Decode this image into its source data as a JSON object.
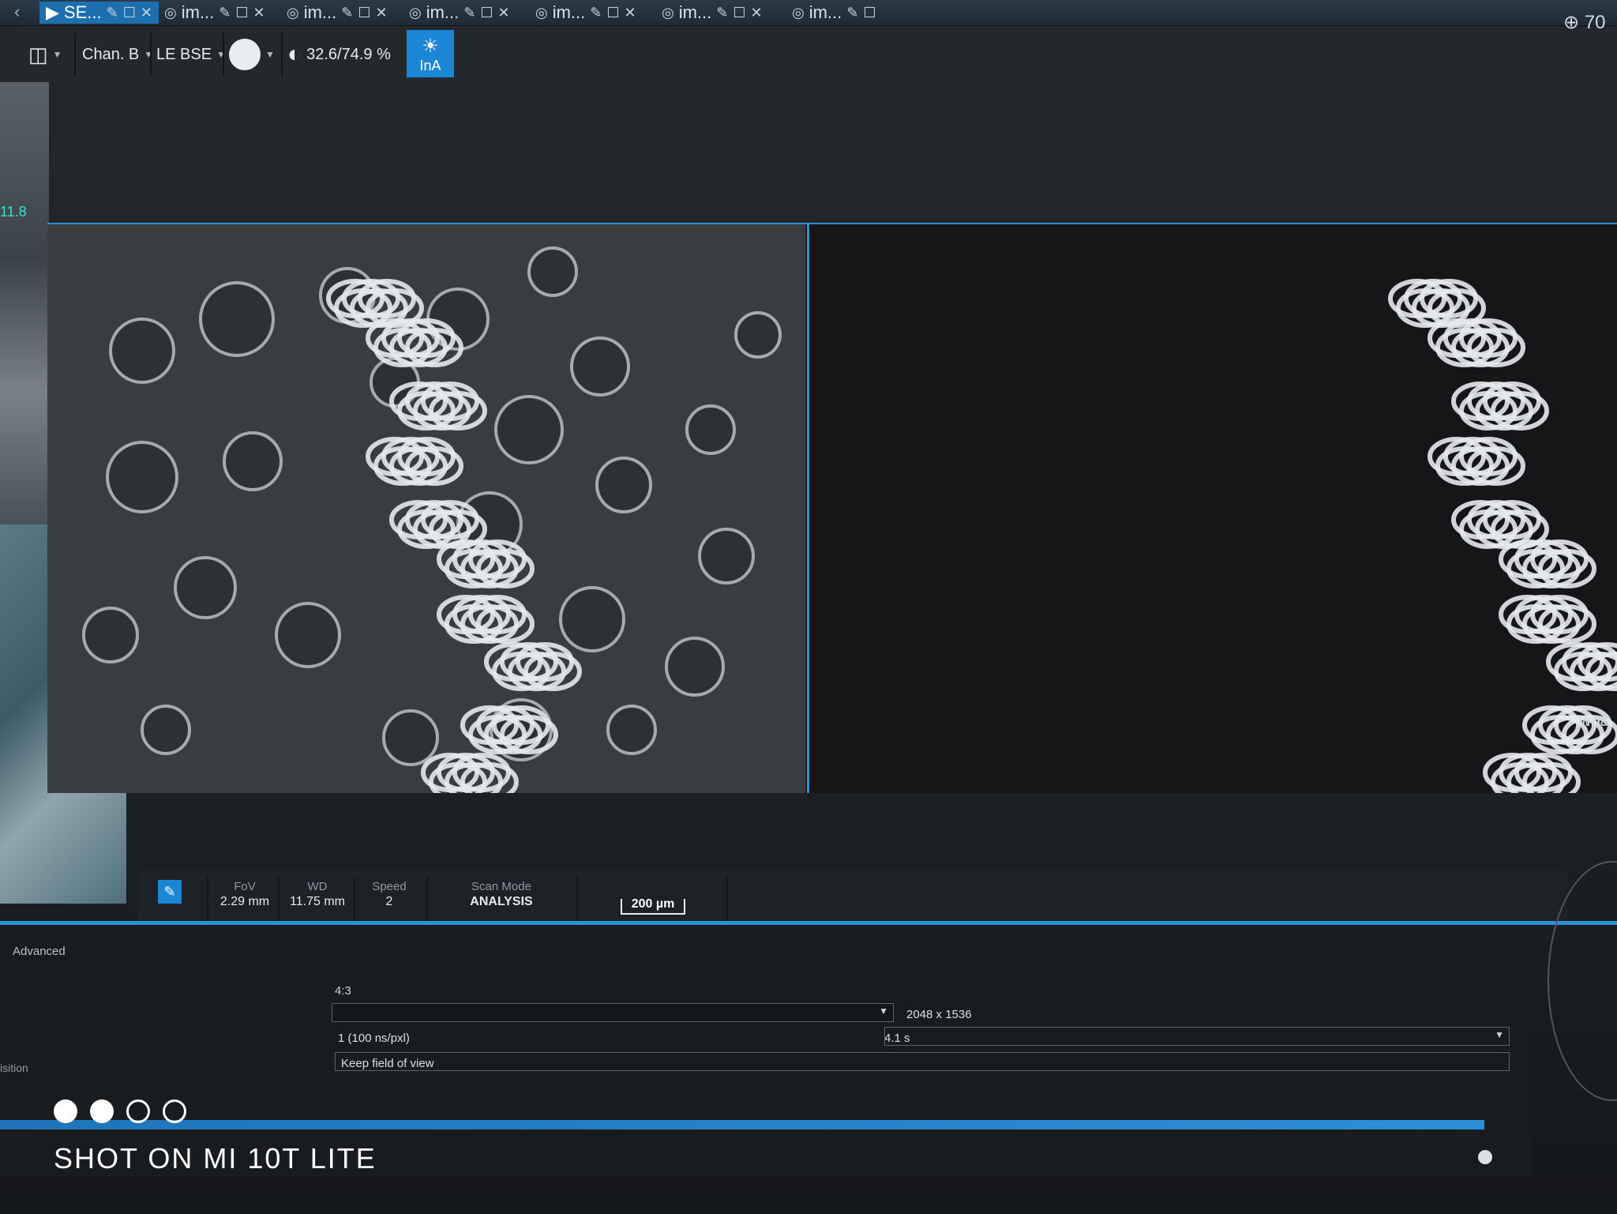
{
  "tabs": [
    {
      "label": "SE...",
      "active": true
    },
    {
      "label": "im...",
      "active": false
    },
    {
      "label": "im...",
      "active": false
    },
    {
      "label": "im...",
      "active": false
    },
    {
      "label": "im...",
      "active": false
    },
    {
      "label": "im...",
      "active": false
    },
    {
      "label": "im...",
      "active": false
    }
  ],
  "toolbar": {
    "channel": "Chan. B",
    "detector": "LE BSE",
    "brightness_contrast": "32.6/74.9 %",
    "ina_label": "InA",
    "zoom_readout": "70"
  },
  "side": {
    "readout": "11.8"
  },
  "status": {
    "fov_label": "FoV",
    "fov_value": "2.29 mm",
    "wd_label": "WD",
    "wd_value": "11.75 mm",
    "speed_label": "Speed",
    "speed_value": "2",
    "scanmode_label": "Scan Mode",
    "scanmode_value": "ANALYSIS",
    "scalebar": "200 µm"
  },
  "advanced": {
    "tab_label": "Advanced",
    "aspect": "4:3",
    "resolution": "2048 x 1536",
    "dwell": "1 (100 ns/pxl)",
    "time": "4.1 s",
    "fov_mode": "Keep field of view",
    "side_label": "isition"
  },
  "right_rail": {
    "label": "WD&"
  },
  "watermark": {
    "text": "SHOT ON MI 10T LITE"
  },
  "colors": {
    "accent": "#2e8fd6",
    "active_tab": "#1e6fb0"
  }
}
